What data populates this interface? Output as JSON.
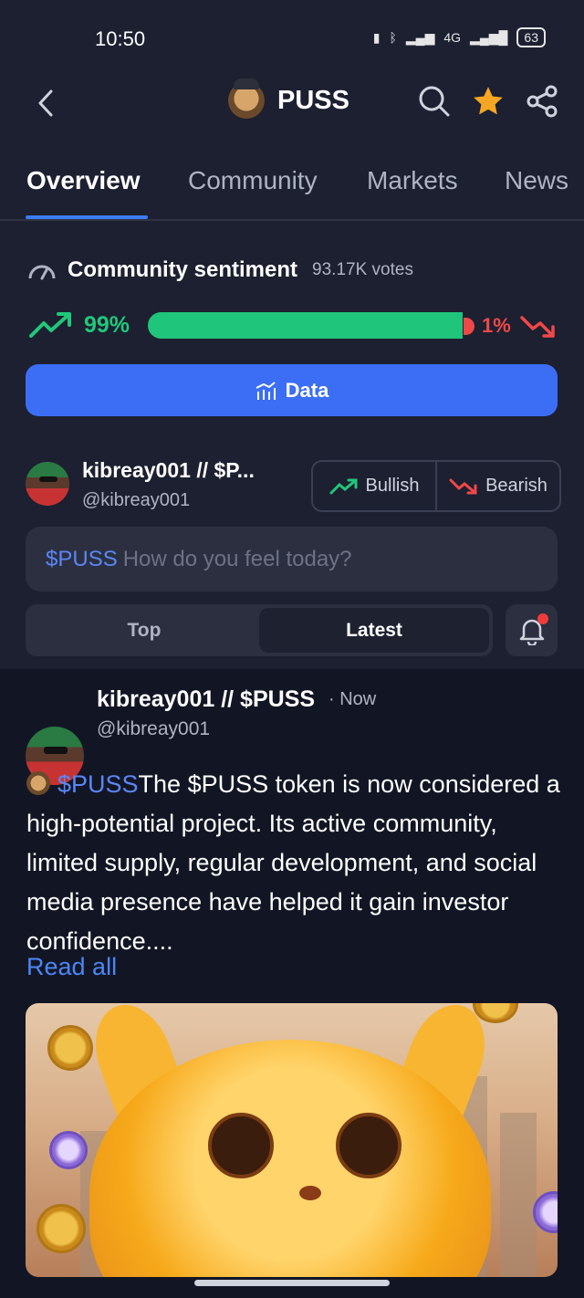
{
  "status_bar": {
    "time": "10:50",
    "network_label": "4G",
    "battery": "63"
  },
  "header": {
    "title": "PUSS",
    "back_icon": "chevron-left-icon",
    "search_icon": "search-icon",
    "star_icon": "star-icon",
    "share_icon": "share-icon",
    "star_color": "#f5a623"
  },
  "tabs": [
    {
      "label": "Overview",
      "active": true
    },
    {
      "label": "Community",
      "active": false
    },
    {
      "label": "Markets",
      "active": false
    },
    {
      "label": "News",
      "active": false
    }
  ],
  "sentiment": {
    "title": "Community sentiment",
    "votes": "93.17K votes",
    "bullish_pct": "99%",
    "bearish_pct": "1%",
    "bullish_fraction": 0.99,
    "bull_color": "#21c77a",
    "bear_color": "#f04848"
  },
  "data_button": {
    "label": "Data"
  },
  "compose_user": {
    "name": "kibreay001 // $P...",
    "handle": "@kibreay001"
  },
  "vote_buttons": {
    "bullish": "Bullish",
    "bearish": "Bearish"
  },
  "compose": {
    "ticker": "$PUSS",
    "placeholder": "How do you feel today?"
  },
  "sort_tabs": [
    {
      "label": "Top",
      "active": false
    },
    {
      "label": "Latest",
      "active": true
    }
  ],
  "post": {
    "author": "kibreay001 // $PUSS",
    "time": "· Now",
    "handle": "@kibreay001",
    "ticker": "$PUSS",
    "text": "The $PUSS token is now considered a high-potential project. Its active community, limited supply, regular development, and social media presence have helped it gain investor confidence....",
    "read_all": "Read all",
    "link_color": "#4c86f5"
  }
}
